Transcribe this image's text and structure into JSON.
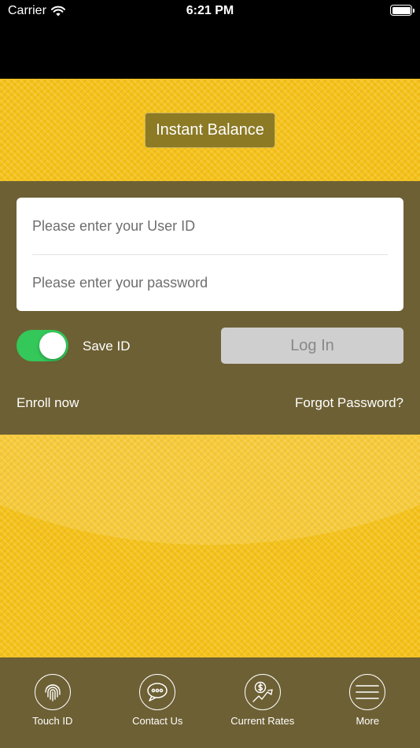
{
  "status_bar": {
    "carrier": "Carrier",
    "time": "6:21 PM"
  },
  "instant_balance": {
    "label": "Instant Balance"
  },
  "login": {
    "user_id_placeholder": "Please enter your User ID",
    "password_placeholder": "Please enter your password",
    "save_id_label": "Save ID",
    "save_id_enabled": true,
    "login_label": "Log In",
    "enroll_label": "Enroll now",
    "forgot_label": "Forgot Password?"
  },
  "tabs": [
    {
      "label": "Touch ID",
      "icon": "fingerprint-icon"
    },
    {
      "label": "Contact Us",
      "icon": "chat-bubble-icon"
    },
    {
      "label": "Current Rates",
      "icon": "dollar-chart-icon"
    },
    {
      "label": "More",
      "icon": "menu-icon"
    }
  ],
  "colors": {
    "yellow": "#f5c21a",
    "olive": "#6d6034",
    "toggle_on": "#34c759",
    "button_olive": "#8c7a25"
  }
}
